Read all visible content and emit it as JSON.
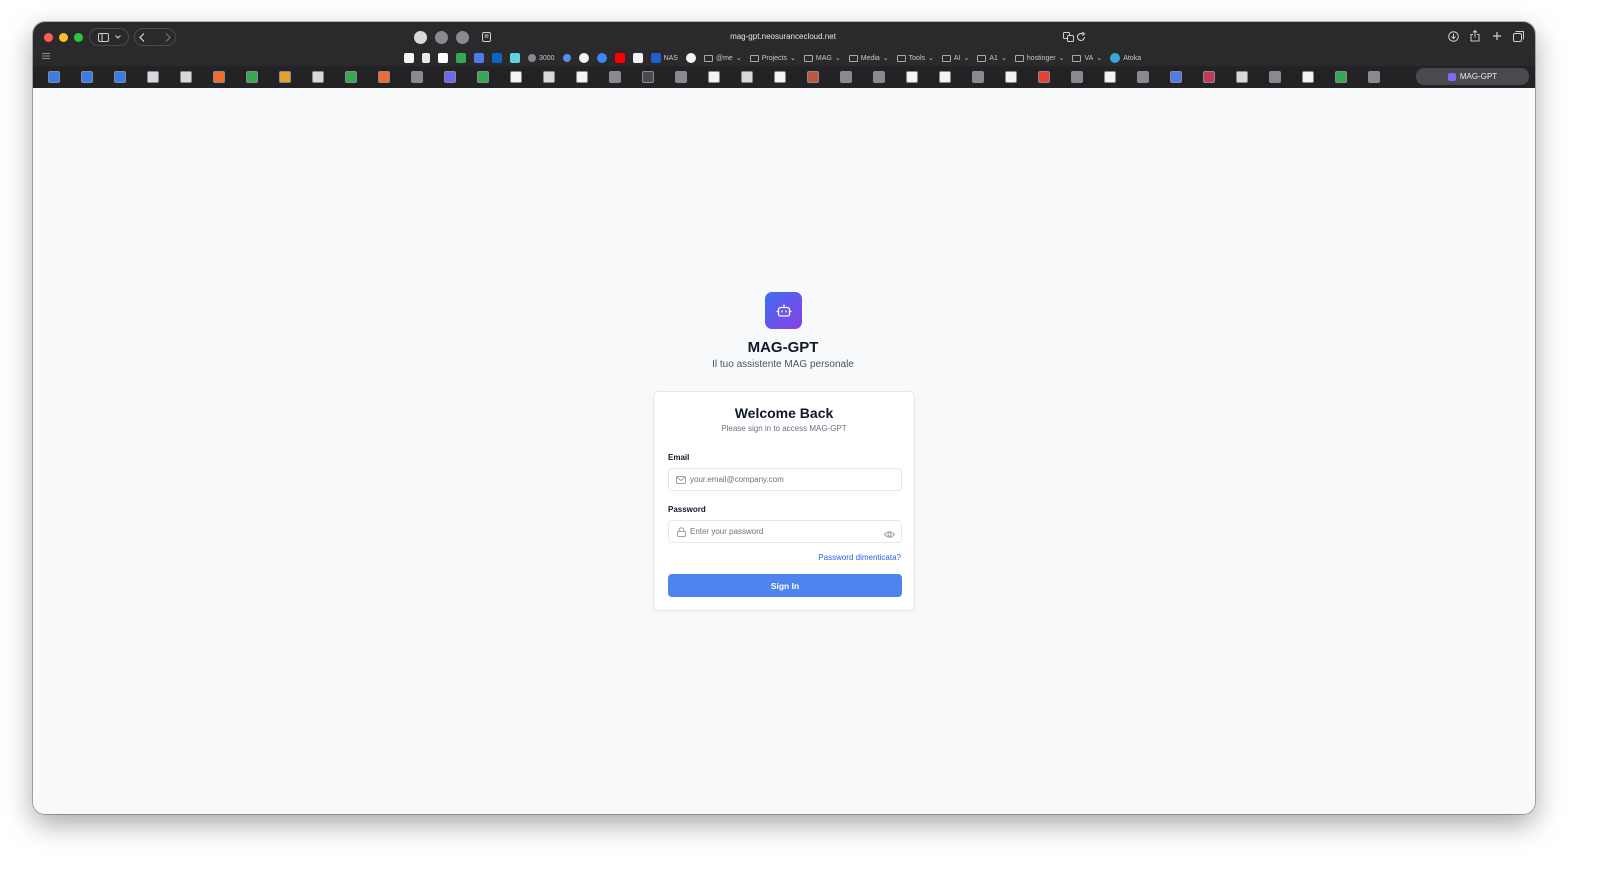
{
  "browser": {
    "url": "mag-gpt.neosurancecloud.net",
    "bookmarks": [
      {
        "label": "3000"
      },
      {
        "label": "NAS"
      },
      {
        "label": "@me"
      },
      {
        "label": "Projects"
      },
      {
        "label": "MAG"
      },
      {
        "label": "Media"
      },
      {
        "label": "Tools"
      },
      {
        "label": "AI"
      },
      {
        "label": "A1"
      },
      {
        "label": "hostinger"
      },
      {
        "label": "VA"
      },
      {
        "label": "Atoka"
      }
    ],
    "active_tab": {
      "label": "MAG-GPT"
    }
  },
  "app": {
    "name": "MAG-GPT",
    "tagline": "Il tuo assistente MAG personale",
    "logo_icon": "robot-icon",
    "brand_gradient": [
      "#3b6ef0",
      "#8b3fe6"
    ]
  },
  "login": {
    "title": "Welcome Back",
    "subtitle": "Please sign in to access MAG-GPT",
    "email_label": "Email",
    "email_placeholder": "your.email@company.com",
    "password_label": "Password",
    "password_placeholder": "Enter your password",
    "forgot_label": "Password dimenticata?",
    "submit_label": "Sign In",
    "accent": "#4f83ee"
  }
}
